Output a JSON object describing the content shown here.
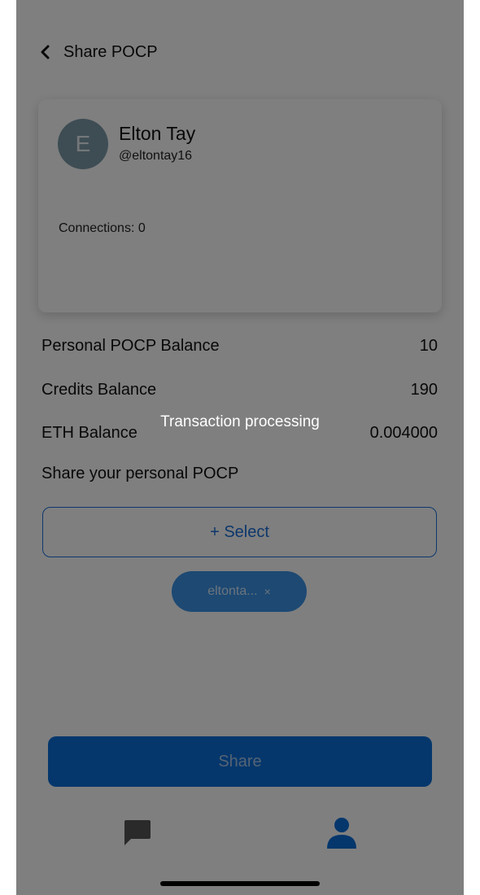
{
  "header": {
    "title": "Share POCP",
    "back_icon": "chevron-left-icon"
  },
  "profile": {
    "avatar_letter": "E",
    "name": "Elton Tay",
    "handle": "@eltontay16",
    "connections": "Connections: 0"
  },
  "balances": [
    {
      "label": "Personal POCP Balance",
      "value": "10"
    },
    {
      "label": "Credits Balance",
      "value": "190"
    },
    {
      "label": "ETH Balance",
      "value": "0.004000"
    }
  ],
  "share_section": {
    "label": "Share your personal POCP",
    "select_label": "+ Select",
    "chip_label": "eltonta...",
    "chip_close": "×",
    "share_button": "Share"
  },
  "tabs": [
    {
      "icon": "chat-icon"
    },
    {
      "icon": "person-icon"
    }
  ],
  "overlay": {
    "message": "Transaction processing"
  },
  "colors": {
    "accent": "#0a6fd8",
    "chip": "#3b93e6",
    "avatar": "#7c9aa8"
  }
}
